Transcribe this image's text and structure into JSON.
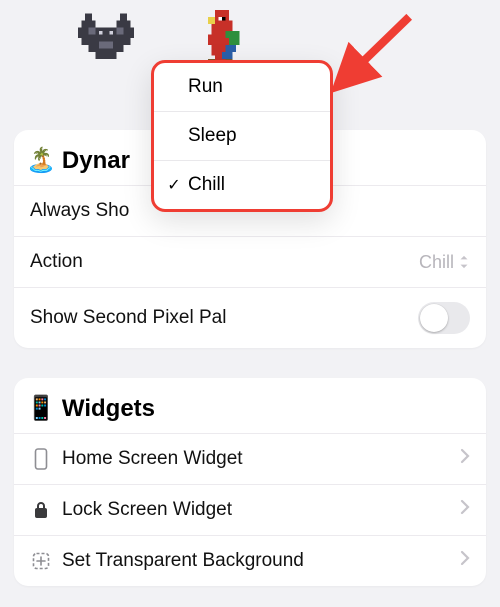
{
  "sprites": {
    "bat_name": "bat-pixel-sprite",
    "parrot_name": "parrot-pixel-sprite"
  },
  "menu": {
    "items": [
      {
        "label": "Run",
        "checked": false
      },
      {
        "label": "Sleep",
        "checked": false
      },
      {
        "label": "Chill",
        "checked": true
      }
    ]
  },
  "sections": {
    "dynamic": {
      "emoji": "🏝️",
      "heading_visible": "Dynar",
      "rows": {
        "always_show": {
          "label_visible": "Always Sho"
        },
        "action": {
          "label": "Action",
          "value": "Chill"
        },
        "show_second": {
          "label": "Show Second Pixel Pal",
          "on": false
        }
      }
    },
    "widgets": {
      "emoji": "📱",
      "heading": "Widgets",
      "rows": [
        {
          "icon": "phone-outline-icon",
          "label": "Home Screen Widget"
        },
        {
          "icon": "lock-icon",
          "label": "Lock Screen Widget"
        },
        {
          "icon": "add-frame-icon",
          "label": "Set Transparent Background"
        }
      ]
    }
  },
  "annotation": {
    "arrow_color": "#ef3d33"
  }
}
